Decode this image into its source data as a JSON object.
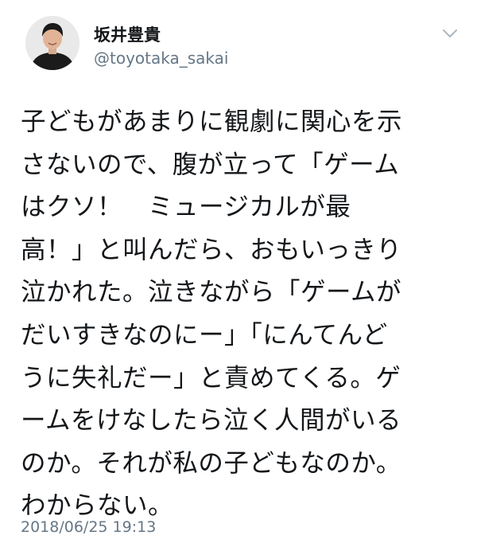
{
  "user": {
    "display_name": "坂井豊貴",
    "handle": "@toyotaka_sakai",
    "avatar_icon": "user-avatar-photo"
  },
  "menu_icon": "chevron-down-icon",
  "tweet": {
    "lines": [
      "子どもがあまりに観劇に関心を示",
      "さないので、腹が立って「ゲーム",
      "はクソ！　ミュージカルが最",
      "高！」と叫んだら、おもいっきり",
      "泣かれた。泣きながら「ゲームが",
      "だいすきなのにー」「にんてんど",
      "うに失礼だー」と責めてくる。ゲ",
      "ームをけなしたら泣く人間がいる",
      "のか。それが私の子どもなのか。",
      "わからない。"
    ],
    "timestamp": "2018/06/25 19:13"
  },
  "colors": {
    "text": "#14171a",
    "secondary": "#657786",
    "background": "#ffffff"
  }
}
